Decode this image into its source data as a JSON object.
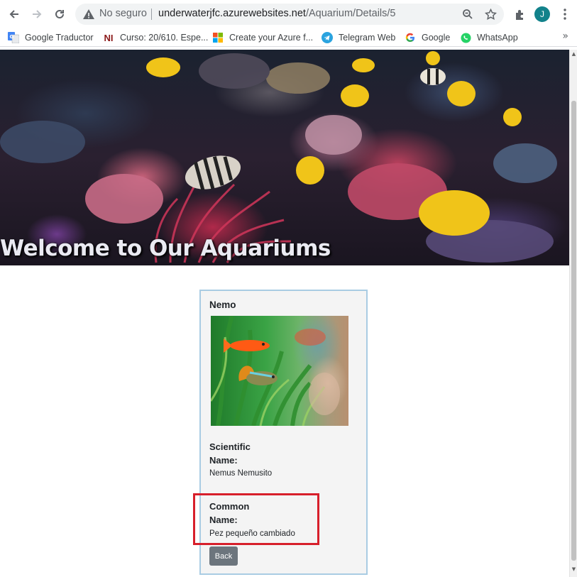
{
  "browser": {
    "security_label": "No seguro",
    "url_host": "underwaterjfc.azurewebsites.net",
    "url_path": "/Aquarium/Details/5",
    "profile_initial": "J",
    "bookmarks": [
      {
        "label": "Google Traductor",
        "icon": "google-translate-icon"
      },
      {
        "label": "Curso: 20/610. Espe...",
        "icon": "ni-icon"
      },
      {
        "label": "Create your Azure f...",
        "icon": "microsoft-icon"
      },
      {
        "label": "Telegram Web",
        "icon": "telegram-icon"
      },
      {
        "label": "Google",
        "icon": "google-icon"
      },
      {
        "label": "WhatsApp",
        "icon": "whatsapp-icon"
      }
    ],
    "more_bookmarks": "»"
  },
  "page": {
    "hero_title": "Welcome to Our Aquariums",
    "fish": {
      "name": "Nemo",
      "scientific_name_label_1": "Scientific",
      "scientific_name_label_2": "Name:",
      "scientific_name": "Nemus Nemusito",
      "common_name_label_1": "Common",
      "common_name_label_2": "Name:",
      "common_name": "Pez pequeño cambiado"
    },
    "back_label": "Back"
  },
  "colors": {
    "card_border": "#a9cce3",
    "highlight_border": "#d71f2b",
    "back_button": "#6c757d",
    "avatar": "#12828b"
  }
}
